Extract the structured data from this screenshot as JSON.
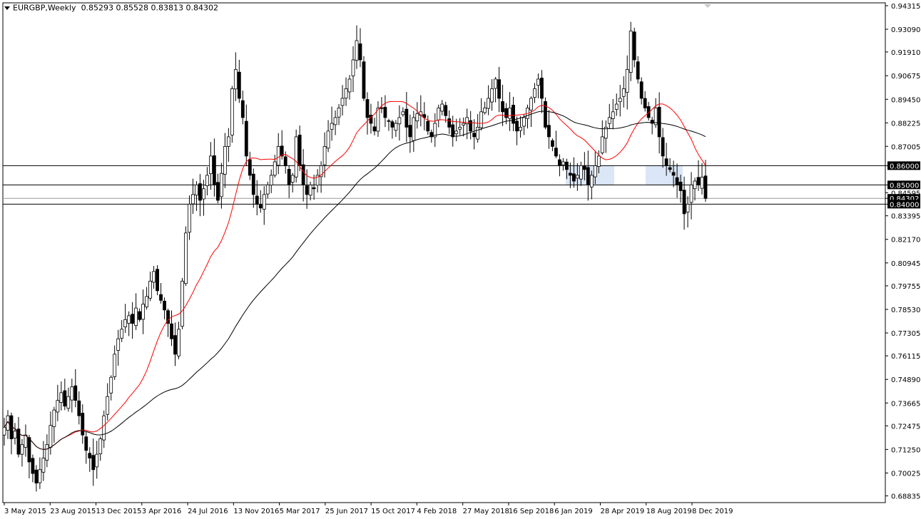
{
  "window": {
    "symbol_label": "EURGBP,Weekly",
    "ohlc_label": "0.85293 0.85528 0.83813 0.84302"
  },
  "chart_data": {
    "type": "candlestick",
    "symbol": "EURGBP",
    "timeframe": "Weekly",
    "ohlc": {
      "open": 0.85293,
      "high": 0.85528,
      "low": 0.83813,
      "close": 0.84302
    },
    "ylim": [
      0.68635,
      0.94315
    ],
    "y_ticks": [
      "0.94315",
      "0.93090",
      "0.91910",
      "0.90675",
      "0.89450",
      "0.88225",
      "0.87005",
      "0.86000",
      "0.85000",
      "0.84595",
      "0.84302",
      "0.84000",
      "0.83395",
      "0.82170",
      "0.80945",
      "0.79755",
      "0.78530",
      "0.77305",
      "0.76115",
      "0.74890",
      "0.73665",
      "0.72475",
      "0.71250",
      "0.70025",
      "0.68835"
    ],
    "x_ticks": [
      "3 May 2015",
      "23 Aug 2015",
      "13 Dec 2015",
      "3 Apr 2016",
      "24 Jul 2016",
      "13 Nov 2016",
      "5 Mar 2017",
      "25 Jun 2017",
      "15 Oct 2017",
      "4 Feb 2018",
      "27 May 2018",
      "16 Sep 2018",
      "6 Jan 2019",
      "28 Apr 2019",
      "18 Aug 2019",
      "8 Dec 2019"
    ],
    "horizontal_lines": [
      0.86,
      0.85,
      0.84302,
      0.84
    ],
    "highlighted_levels": [
      "0.86000",
      "0.85000",
      "0.84302",
      "0.84000"
    ],
    "close_series": [
      0.724,
      0.73,
      0.718,
      0.722,
      0.71,
      0.715,
      0.72,
      0.706,
      0.7,
      0.695,
      0.702,
      0.708,
      0.715,
      0.725,
      0.733,
      0.738,
      0.742,
      0.735,
      0.74,
      0.745,
      0.738,
      0.73,
      0.72,
      0.712,
      0.708,
      0.702,
      0.71,
      0.718,
      0.73,
      0.74,
      0.75,
      0.762,
      0.77,
      0.775,
      0.78,
      0.782,
      0.778,
      0.786,
      0.78,
      0.788,
      0.792,
      0.8,
      0.805,
      0.795,
      0.79,
      0.785,
      0.778,
      0.77,
      0.762,
      0.775,
      0.8,
      0.825,
      0.84,
      0.845,
      0.85,
      0.842,
      0.848,
      0.855,
      0.865,
      0.85,
      0.842,
      0.856,
      0.87,
      0.875,
      0.9,
      0.91,
      0.895,
      0.885,
      0.865,
      0.855,
      0.845,
      0.84,
      0.838,
      0.845,
      0.85,
      0.855,
      0.862,
      0.87,
      0.865,
      0.86,
      0.85,
      0.855,
      0.875,
      0.86,
      0.85,
      0.845,
      0.85,
      0.848,
      0.855,
      0.86,
      0.87,
      0.878,
      0.882,
      0.885,
      0.89,
      0.895,
      0.9,
      0.905,
      0.915,
      0.925,
      0.915,
      0.895,
      0.885,
      0.882,
      0.878,
      0.89,
      0.89,
      0.885,
      0.883,
      0.88,
      0.882,
      0.885,
      0.888,
      0.88,
      0.875,
      0.885,
      0.887,
      0.888,
      0.885,
      0.878,
      0.875,
      0.882,
      0.89,
      0.892,
      0.886,
      0.88,
      0.875,
      0.878,
      0.88,
      0.882,
      0.885,
      0.878,
      0.875,
      0.88,
      0.888,
      0.89,
      0.895,
      0.9,
      0.905,
      0.895,
      0.888,
      0.885,
      0.89,
      0.882,
      0.878,
      0.88,
      0.885,
      0.89,
      0.895,
      0.9,
      0.905,
      0.895,
      0.88,
      0.875,
      0.87,
      0.865,
      0.86,
      0.862,
      0.858,
      0.855,
      0.852,
      0.855,
      0.86,
      0.858,
      0.85,
      0.855,
      0.86,
      0.865,
      0.875,
      0.88,
      0.885,
      0.888,
      0.892,
      0.895,
      0.9,
      0.91,
      0.93,
      0.915,
      0.905,
      0.895,
      0.89,
      0.885,
      0.882,
      0.89,
      0.875,
      0.865,
      0.86,
      0.858,
      0.855,
      0.85,
      0.847,
      0.835,
      0.84,
      0.85,
      0.852,
      0.85,
      0.854,
      0.843
    ],
    "moving_averages": [
      {
        "color": "#ff0000"
      },
      {
        "color": "#000000"
      }
    ]
  }
}
